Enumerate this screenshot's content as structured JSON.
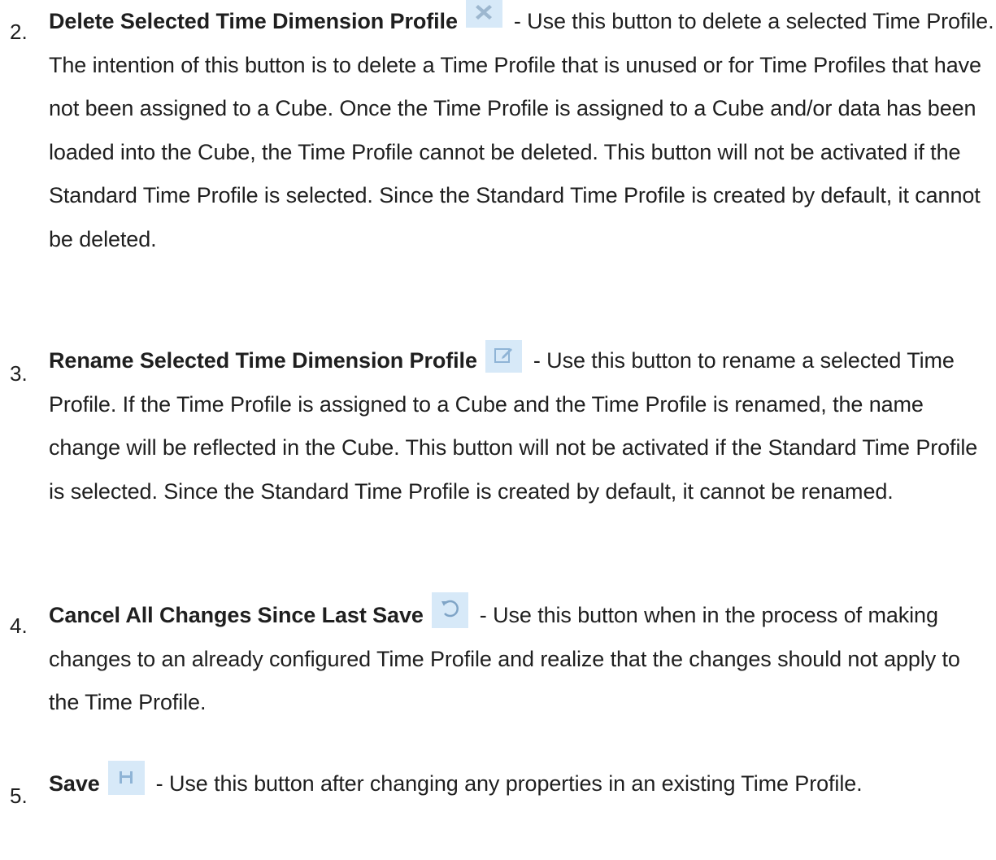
{
  "items": [
    {
      "number": "2.",
      "title": "Delete Selected Time Dimension Profile",
      "icon": "delete-x-icon",
      "text": "- Use this button to delete a selected Time Profile. The intention of this button is to delete a Time Profile that is unused or for Time Profiles that have not been assigned to a Cube. Once the Time Profile is assigned to a Cube and/or data has been loaded into the Cube, the Time Profile cannot be deleted. This button will not be activated if the Standard Time Profile is selected. Since the Standard Time Profile is created by default, it cannot be deleted."
    },
    {
      "number": "3.",
      "title": "Rename Selected Time Dimension Profile",
      "icon": "rename-edit-icon",
      "text": "- Use this button to rename a selected Time Profile. If the Time Profile is assigned to a Cube and the Time Profile is renamed, the name change will be reflected in the Cube. This button will not be activated if the Standard Time Profile is selected. Since the Standard Time Profile is created by default, it cannot be renamed."
    },
    {
      "number": "4.",
      "title": "Cancel All Changes Since Last Save",
      "icon": "undo-icon",
      "text": "- Use this button when in the process of making changes to an already configured Time Profile and realize that the changes should not apply to the Time Profile."
    },
    {
      "number": "5.",
      "title": "Save",
      "icon": "save-floppy-icon",
      "text": "- Use this button after changing any properties in an existing Time Profile."
    }
  ],
  "colors": {
    "text": "#1f1f1f",
    "icon_bg": "#d7e9f8",
    "icon_fg": "#8fb4d6"
  }
}
